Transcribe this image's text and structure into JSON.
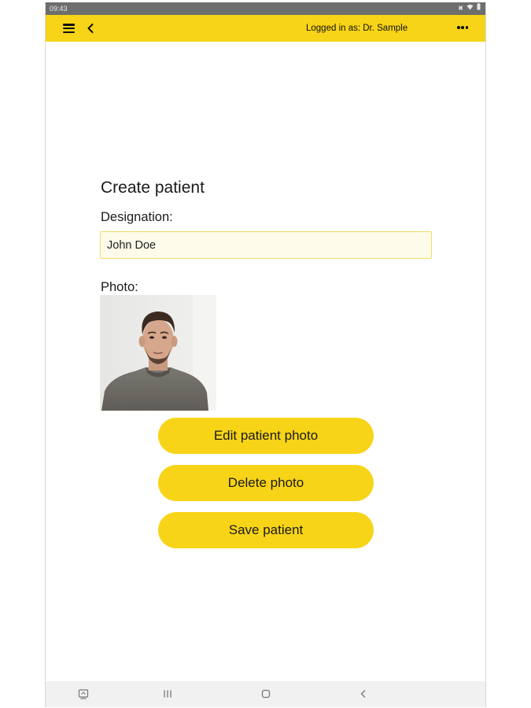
{
  "status_bar": {
    "time": "09:43",
    "icons": [
      "mute-icon",
      "wifi-icon",
      "battery-icon"
    ]
  },
  "app_bar": {
    "logged_in_text": "Logged in as: Dr. Sample",
    "menu_icon": "hamburger-menu-icon",
    "back_icon": "chevron-left-icon",
    "more_icon": "more-horizontal-icon",
    "accent_color": "#f7d417"
  },
  "form": {
    "title": "Create patient",
    "designation_label": "Designation:",
    "designation_value": "John Doe",
    "photo_label": "Photo:"
  },
  "buttons": {
    "edit_photo": "Edit patient photo",
    "delete_photo": "Delete photo",
    "save_patient": "Save patient"
  },
  "nav_bar": {
    "items": [
      "keyboard-icon",
      "recents-icon",
      "home-icon",
      "back-icon"
    ]
  }
}
